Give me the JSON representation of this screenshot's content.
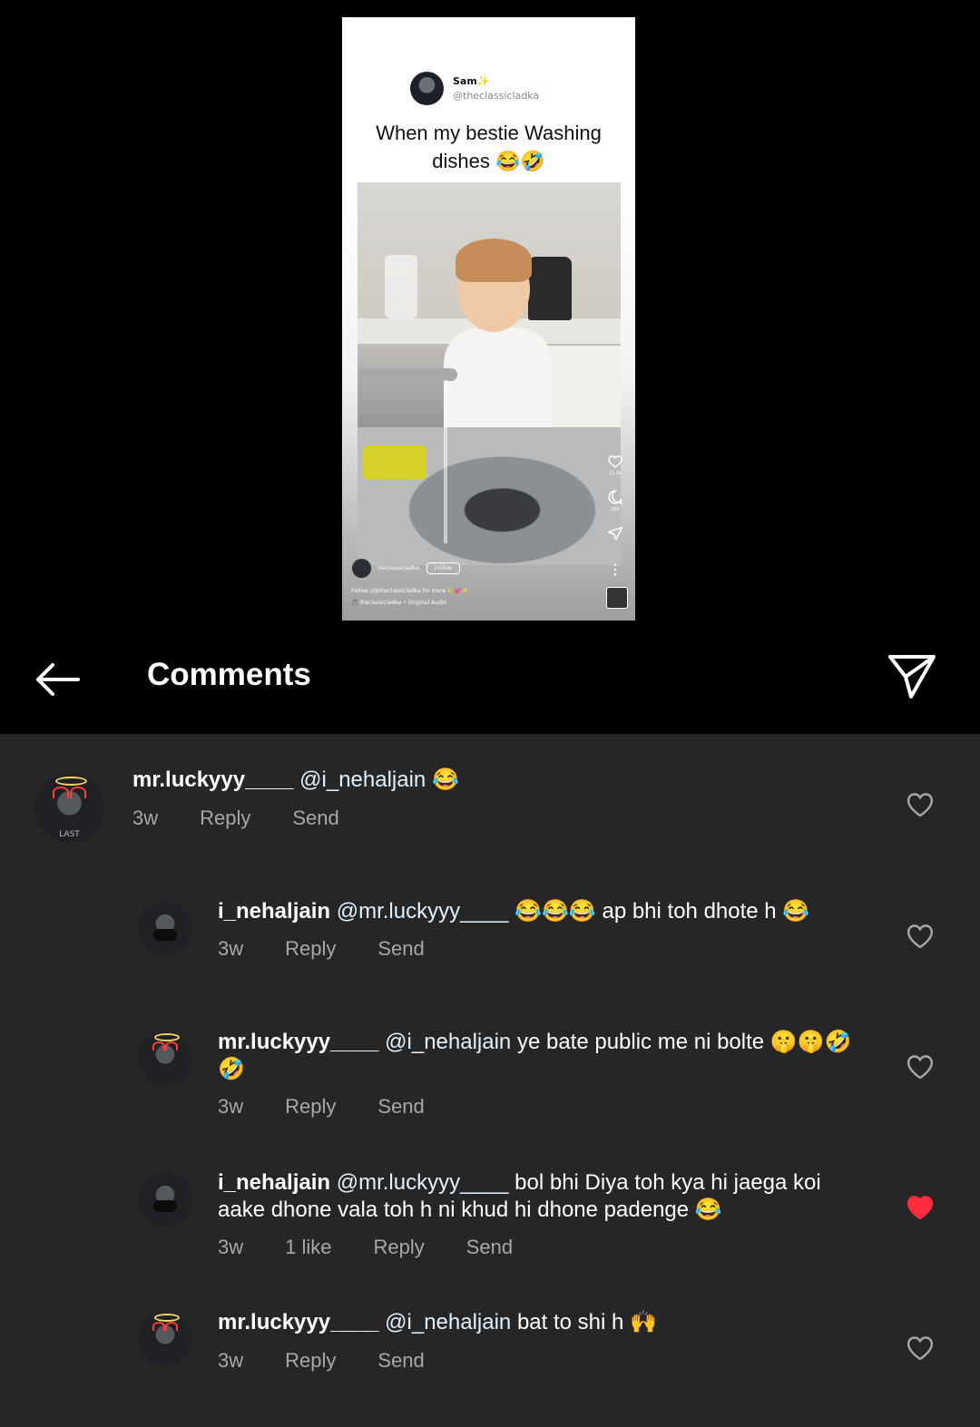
{
  "preview": {
    "author_name": "Sam",
    "author_handle": "@theclassicladka",
    "caption_line1": "When my bestie Washing",
    "caption_line2": "dishes 😂🤣",
    "like_count": "11.5k",
    "comment_count": "299",
    "footer_user": "theclassicladka",
    "footer_follow": "Follow",
    "footer_caption": "Follow //@theclassicladka for more 💫💕✨",
    "footer_audio": "🎵 theclassicladka • Original Audio"
  },
  "header": {
    "title": "Comments"
  },
  "comments": [
    {
      "user": "mr.luckyyy____",
      "mention": "@i_nehaljain",
      "text_line1": "😂",
      "text_line2": "",
      "time": "3w",
      "likes": "",
      "reply": "Reply",
      "send": "Send",
      "liked": false
    },
    {
      "user": "i_nehaljain",
      "mention": "@mr.luckyyy____",
      "text_line1": "😂😂😂 ap bhi toh dhote h 😂",
      "text_line2": "",
      "time": "3w",
      "likes": "",
      "reply": "Reply",
      "send": "Send",
      "liked": false
    },
    {
      "user": "mr.luckyyy____",
      "mention": "@i_nehaljain",
      "text_line1": "ye bate public me ni bolte 🤫🤫🤣",
      "text_line2": "🤣",
      "time": "3w",
      "likes": "",
      "reply": "Reply",
      "send": "Send",
      "liked": false
    },
    {
      "user": "i_nehaljain",
      "mention": "@mr.luckyyy____",
      "text_line1": "bol bhi Diya toh kya hi jaega koi",
      "text_line2": "aake dhone vala toh h ni khud hi dhone padenge 😂",
      "time": "3w",
      "likes": "1 like",
      "reply": "Reply",
      "send": "Send",
      "liked": true
    },
    {
      "user": "mr.luckyyy____",
      "mention": "@i_nehaljain",
      "text_line1": "bat to shi h 🙌",
      "text_line2": "",
      "time": "3w",
      "likes": "",
      "reply": "Reply",
      "send": "Send",
      "liked": false
    }
  ],
  "colors": {
    "liked_heart": "#ff2d3f",
    "comment_bg": "#262626",
    "meta_text": "#a8a8a8"
  }
}
